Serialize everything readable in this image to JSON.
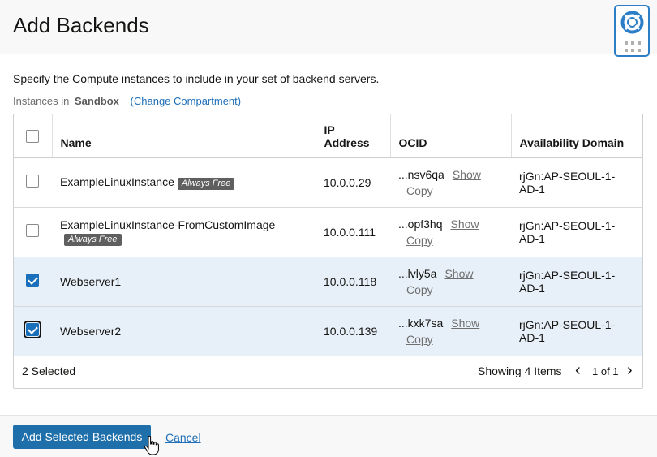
{
  "dialog": {
    "title": "Add Backends",
    "intro": "Specify the Compute instances to include in your set of backend servers.",
    "instances_label": "Instances in",
    "compartment_name": "Sandbox",
    "change_compartment": "(Change Compartment)"
  },
  "table": {
    "headers": {
      "name": "Name",
      "ip": "IP Address",
      "ocid": "OCID",
      "ad": "Availability Domain"
    },
    "rows": [
      {
        "name": "ExampleLinuxInstance",
        "badge": "Always Free",
        "ip": "10.0.0.29",
        "ocid": "...nsv6qa",
        "show": "Show",
        "copy": "Copy",
        "ad": "rjGn:AP-SEOUL-1-AD-1",
        "checked": false
      },
      {
        "name": "ExampleLinuxInstance-FromCustomImage",
        "badge": "Always Free",
        "ip": "10.0.0.111",
        "ocid": "...opf3hq",
        "show": "Show",
        "copy": "Copy",
        "ad": "rjGn:AP-SEOUL-1-AD-1",
        "checked": false
      },
      {
        "name": "Webserver1",
        "badge": "",
        "ip": "10.0.0.118",
        "ocid": "...lvly5a",
        "show": "Show",
        "copy": "Copy",
        "ad": "rjGn:AP-SEOUL-1-AD-1",
        "checked": true
      },
      {
        "name": "Webserver2",
        "badge": "",
        "ip": "10.0.0.139",
        "ocid": "...kxk7sa",
        "show": "Show",
        "copy": "Copy",
        "ad": "rjGn:AP-SEOUL-1-AD-1",
        "checked": true
      }
    ],
    "selected_count": "2 Selected",
    "showing": "Showing 4 Items",
    "page": "1 of 1"
  },
  "actions": {
    "primary": "Add Selected Backends",
    "cancel": "Cancel"
  },
  "icons": {
    "help": "lifebuoy-icon",
    "apps": "grid-dots-icon",
    "prev": "chevron-left-icon",
    "next": "chevron-right-icon",
    "cursor": "hand-pointer-icon"
  },
  "colors": {
    "primary": "#1f6fab",
    "link": "#1e6fb8",
    "selected_row": "#e7f0f8",
    "badge": "#5f5f5f"
  }
}
